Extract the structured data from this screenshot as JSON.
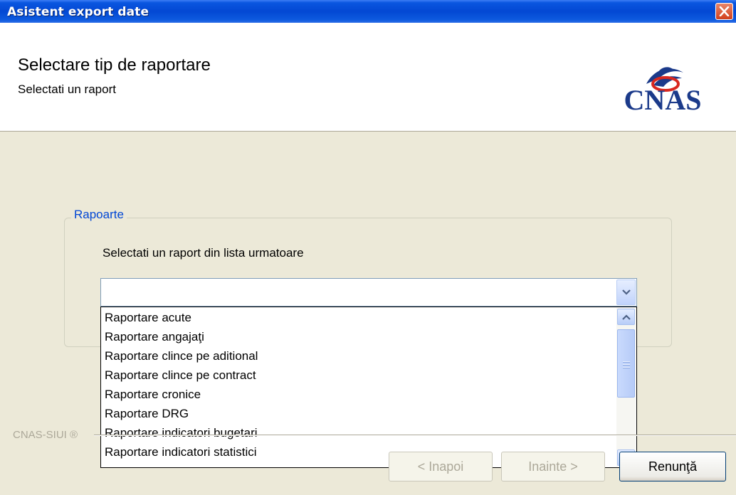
{
  "window": {
    "title": "Asistent export date"
  },
  "header": {
    "title": "Selectare tip de raportare",
    "subtitle": "Selectati un raport",
    "logo_text": "CNAS"
  },
  "group": {
    "legend": "Rapoarte",
    "hint": "Selectati un raport din lista urmatoare"
  },
  "combo": {
    "value": ""
  },
  "list": {
    "items": [
      "Raportare acute",
      "Raportare angajaţi",
      "Raportare clince pe aditional",
      "Raportare clince pe contract",
      "Raportare cronice",
      "Raportare DRG",
      "Raportare indicatori bugetari",
      "Raportare indicatori statistici"
    ]
  },
  "footer": {
    "version": "CNAS-SIUI ®",
    "back_label": "< Inapoi",
    "next_label": "Inainte >",
    "cancel_label": "Renunţă"
  },
  "colors": {
    "titlebar": "#0348d3",
    "legend": "#0046d5",
    "logo_blue": "#1b3a8a",
    "logo_red": "#d8271f"
  },
  "icons": [
    "close-icon",
    "chevron-down-icon",
    "chevron-up-icon",
    "cnas-logo"
  ]
}
